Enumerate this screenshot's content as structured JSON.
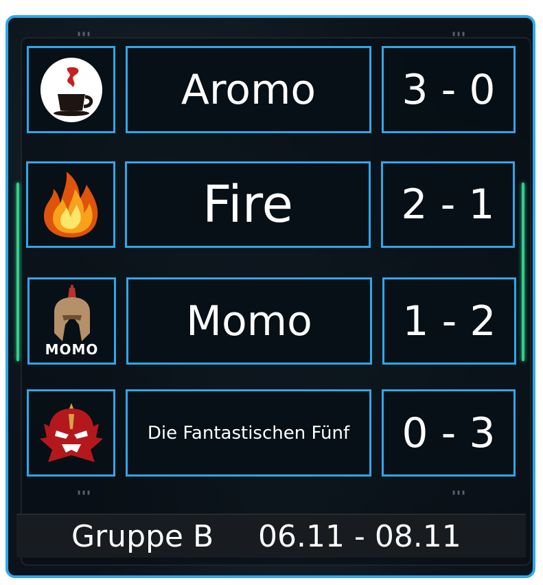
{
  "teams": [
    {
      "name": "Aromo",
      "score": "3 - 0",
      "logo_icon": "coffee-cup-icon"
    },
    {
      "name": "Fire",
      "score": "2 - 1",
      "logo_icon": "flame-icon"
    },
    {
      "name": "Momo",
      "score": "1 - 2",
      "logo_icon": "spartan-helmet-icon",
      "logo_text": "MOMO"
    },
    {
      "name": "Die Fantastischen Fünf",
      "score": "0 - 3",
      "logo_icon": "red-demon-mask-icon"
    }
  ],
  "footer": {
    "group": "Gruppe B",
    "dates": "06.11 - 08.11"
  },
  "colors": {
    "border": "#2ea8ec",
    "panel": "#0b1219",
    "accent_light": "#2ecf8a"
  }
}
